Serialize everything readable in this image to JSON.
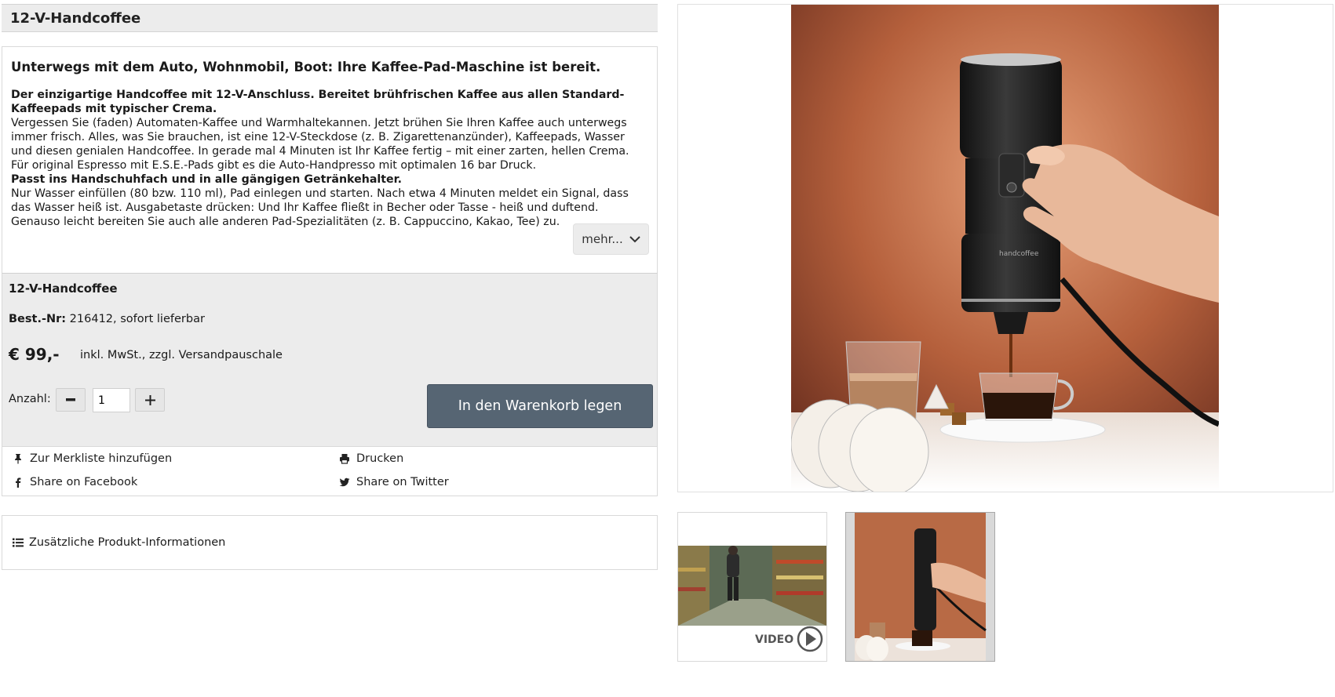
{
  "product": {
    "title": "12-V-Handcoffee",
    "headline": "Unterwegs mit dem Auto, Wohnmobil, Boot: Ihre Kaffee-Pad-Maschine ist bereit.",
    "desc_bold_1": "Der einzigartige Handcoffee mit 12-V-Anschluss. Bereitet brühfrischen Kaffee aus allen Standard-Kaffeepads mit typischer Crema.",
    "desc_text_1": "Vergessen Sie (faden) Automaten-Kaffee und Warmhaltekannen. Jetzt brühen Sie Ihren Kaffee auch unterwegs immer frisch. Alles, was Sie brauchen, ist eine 12-V-Steckdose (z. B. Zigarettenanzünder), Kaffeepads, Wasser und diesen genialen Handcoffee. In gerade mal 4 Minuten ist Ihr Kaffee fertig – mit einer zarten, hellen Crema. Für original Espresso mit E.S.E.-Pads gibt es die Auto-Handpresso mit optimalen 16 bar Druck.",
    "desc_bold_2": "Passt ins Handschuhfach und in alle gängigen Getränkehalter.",
    "desc_text_2": "Nur Wasser einfüllen (80 bzw. 110 ml), Pad einlegen und starten. Nach etwa 4 Minuten meldet ein Signal, dass das Wasser heiß ist. Ausgabetaste drücken: Und Ihr Kaffee fließt in Becher oder Tasse - heiß und duftend.",
    "desc_text_3": "Genauso leicht bereiten Sie auch alle anderen Pad-Spezialitäten (z. B. Cappuccino, Kakao, Tee) zu.",
    "more_label": "mehr..."
  },
  "order": {
    "name": "12-V-Handcoffee",
    "nr_label": "Best.-Nr:",
    "nr_value": "216412, sofort lieferbar",
    "price": "€ 99,-",
    "price_note": "inkl. MwSt., zzgl. Versandpauschale",
    "qty_label": "Anzahl:",
    "qty_value": "1",
    "cart_label": "In den Warenkorb legen"
  },
  "actions": {
    "wishlist": "Zur Merkliste hinzufügen",
    "print": "Drucken",
    "facebook": "Share on Facebook",
    "twitter": "Share on Twitter"
  },
  "extra_info_label": "Zusätzliche Produkt-Informationen",
  "thumbs": {
    "video_label": "VIDEO"
  },
  "image_brand_text": "handcoffee",
  "colors": {
    "cart_button": "#566573",
    "panel_bg": "#ececec",
    "border": "#d9d9d9"
  }
}
